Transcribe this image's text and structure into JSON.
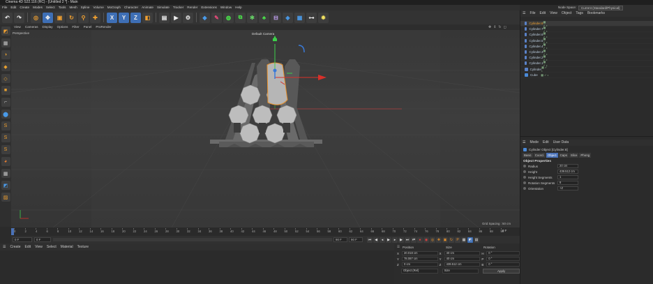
{
  "app": {
    "title": "Cinema 4D S22.116 (RC) - [Untitled 2 *] - Main",
    "node_space_label": "Node Space:",
    "node_space_value": "Current (Standard/Physical)"
  },
  "menubar": [
    "File",
    "Edit",
    "Create",
    "Modes",
    "Select",
    "Tools",
    "Mesh",
    "Spline",
    "Volume",
    "MoGraph",
    "Character",
    "Animate",
    "Simulate",
    "Tracker",
    "Render",
    "Extensions",
    "Window",
    "Help"
  ],
  "toolbar": {
    "icons": [
      "undo-icon",
      "redo-icon",
      "live-selection-icon",
      "move-icon",
      "scale-icon",
      "rotate-icon",
      "recent-tools-icon",
      "x-axis-icon",
      "y-axis-icon",
      "z-axis-icon",
      "coordinate-system-icon",
      "render-region-icon",
      "render-view-icon",
      "render-settings-icon",
      "cube-icon",
      "pen-icon",
      "subdivision-icon",
      "cloner-icon",
      "character-icon",
      "deformer-icon",
      "camera-icon",
      "floor-icon",
      "light-icon"
    ],
    "xyz": [
      "X",
      "Y",
      "Z"
    ]
  },
  "viewport": {
    "menu": [
      "View",
      "Cameras",
      "Display",
      "Options",
      "Filter",
      "Panel",
      "ProRender"
    ],
    "label": "Perspective",
    "camera": "Default Camera",
    "grid_spacing": "Grid Spacing : 50 cm"
  },
  "timeline": {
    "ticks": [
      "0",
      "2",
      "4",
      "6",
      "8",
      "10",
      "12",
      "14",
      "16",
      "18",
      "20",
      "22",
      "24",
      "26",
      "28",
      "30",
      "32",
      "34",
      "36",
      "38",
      "40",
      "42",
      "44",
      "46",
      "48",
      "50",
      "52",
      "54",
      "56",
      "58",
      "60",
      "62",
      "64",
      "66",
      "68",
      "70",
      "72",
      "74",
      "76",
      "78",
      "80",
      "82",
      "84",
      "86",
      "88",
      "90"
    ],
    "end_label": "0 F",
    "current_frame": "0 F",
    "start_frame": "0 F",
    "end_frame": "90 F",
    "end_frame2": "90 F"
  },
  "material_menu": [
    "Create",
    "Edit",
    "View",
    "Select",
    "Material",
    "Texture"
  ],
  "coord": {
    "headers": [
      "Position",
      "Size",
      "Rotation"
    ],
    "rows": [
      {
        "axis": "X",
        "pos": "20.018 cm",
        "size_axis": "X",
        "size": "40 cm",
        "rot_axis": "H",
        "rot": "0 °"
      },
      {
        "axis": "Y",
        "pos": "78.087 cm",
        "size_axis": "Y",
        "size": "40 cm",
        "rot_axis": "P",
        "rot": "0 °"
      },
      {
        "axis": "Z",
        "pos": "0 cm",
        "size_axis": "Z",
        "size": "439.512 cm",
        "rot_axis": "B",
        "rot": "0 °"
      }
    ],
    "mode": "Object (Rel)",
    "size_mode": "Size",
    "apply": "Apply"
  },
  "object_manager": {
    "menu": [
      "File",
      "Edit",
      "View",
      "Object",
      "Tags",
      "Bookmarks"
    ],
    "objects": [
      "Cylinder.8",
      "Cylinder.7",
      "Cylinder.6",
      "Cylinder.5",
      "Cylinder.4",
      "Cylinder.3",
      "Cylinder.2",
      "Cylinder.1",
      "Cylinder",
      "Cube"
    ],
    "selected_index": 0
  },
  "attributes": {
    "menu": [
      "Mode",
      "Edit",
      "User Data"
    ],
    "title": "Cylinder Object [Cylinder.8]",
    "tabs": [
      "Basic",
      "Coord.",
      "Object",
      "Caps",
      "Slice",
      "Phong"
    ],
    "active_tab": "Object",
    "section": "Object Properties",
    "props": [
      {
        "label": "Radius",
        "value": "20 cm"
      },
      {
        "label": "Height",
        "value": "439.512 cm"
      },
      {
        "label": "Height Segments",
        "value": "1"
      },
      {
        "label": "Rotation Segments",
        "value": "8"
      },
      {
        "label": "Orientation",
        "value": "+Z"
      }
    ]
  },
  "colors": {
    "accent": "#4a72b8",
    "selection_orange": "#e8902a",
    "axis_green": "#3cd04a",
    "axis_red": "#d8302a",
    "axis_blue": "#3a7ad8"
  }
}
